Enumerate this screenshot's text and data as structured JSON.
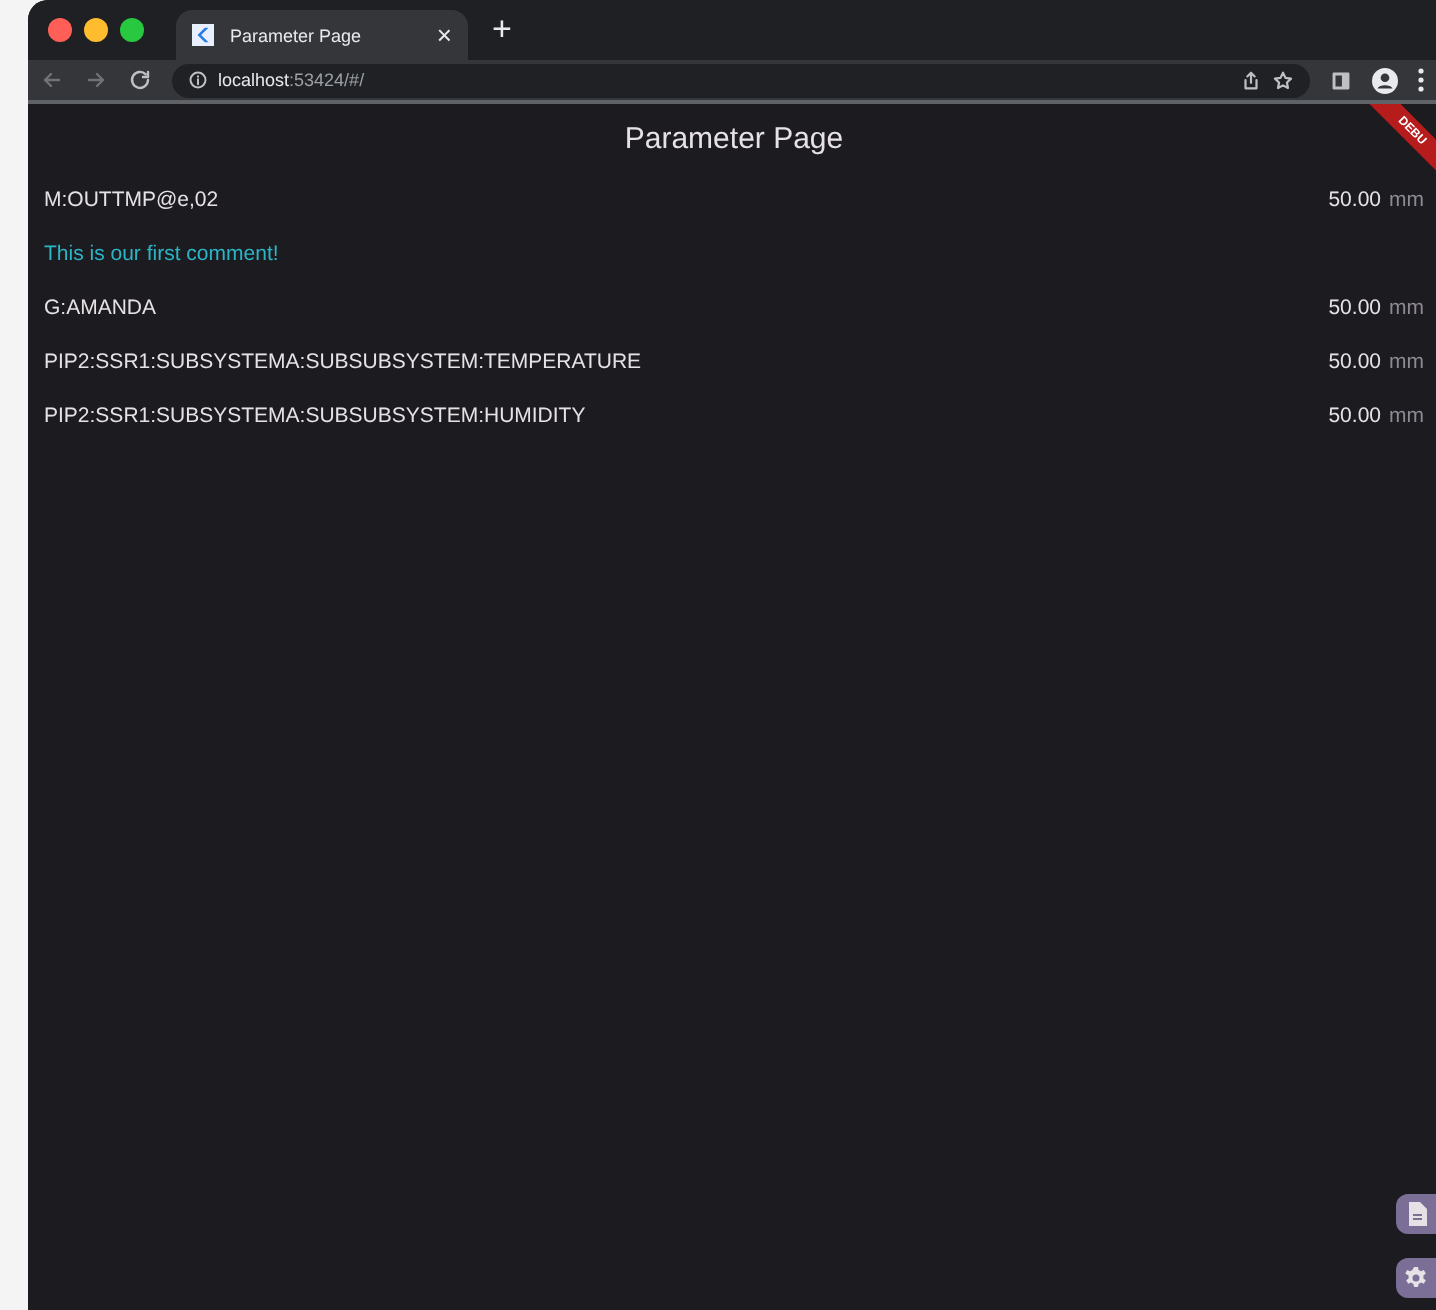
{
  "browser": {
    "tab": {
      "title": "Parameter Page",
      "close": "×"
    },
    "new_tab": "+",
    "url": {
      "host": "localhost",
      "rest": ":53424/#/"
    }
  },
  "page": {
    "title": "Parameter Page",
    "debug_banner": "DEBU",
    "rows": [
      {
        "kind": "parameter",
        "name": "M:OUTTMP@e,02",
        "value": "50.00",
        "unit": "mm"
      },
      {
        "kind": "comment",
        "text": "This is our first comment!"
      },
      {
        "kind": "parameter",
        "name": "G:AMANDA",
        "value": "50.00",
        "unit": "mm"
      },
      {
        "kind": "parameter",
        "name": "PIP2:SSR1:SUBSYSTEMA:SUBSUBSYSTEM:TEMPERATURE",
        "value": "50.00",
        "unit": "mm"
      },
      {
        "kind": "parameter",
        "name": "PIP2:SSR1:SUBSYSTEMA:SUBSUBSYSTEM:HUMIDITY",
        "value": "50.00",
        "unit": "mm"
      }
    ]
  }
}
